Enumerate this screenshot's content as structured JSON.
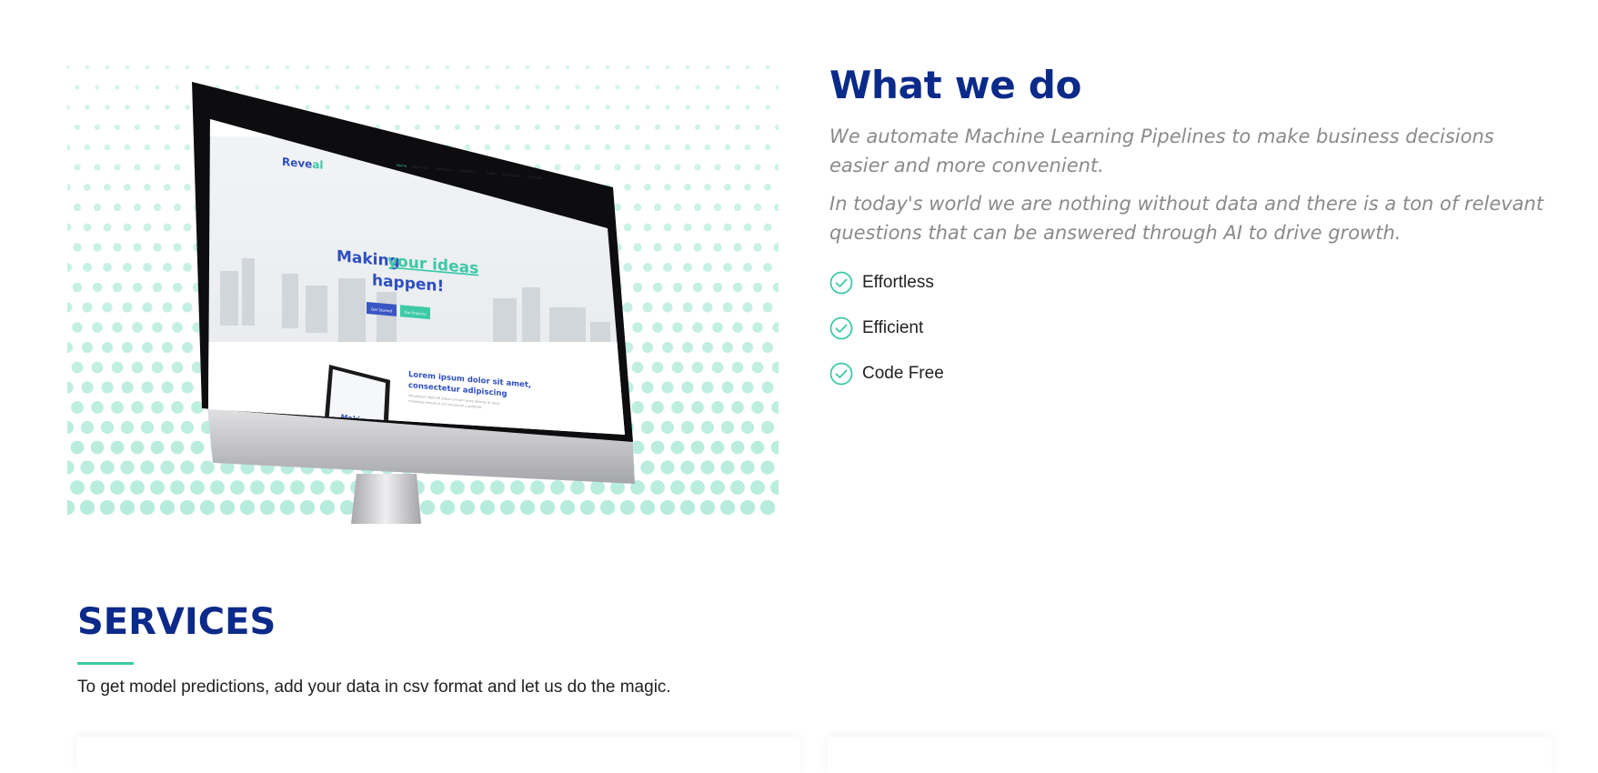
{
  "about": {
    "title": "What we do",
    "lead": "We automate Machine Learning Pipelines to make business decisions easier and more convenient.",
    "text": "In today's world we are nothing without data and there is a ton of relevant questions that can be answered through AI to drive growth.",
    "features": [
      {
        "label": "Effortless",
        "icon": "check-circle-icon"
      },
      {
        "label": "Efficient",
        "icon": "check-circle-icon"
      },
      {
        "label": "Code Free",
        "icon": "check-circle-icon"
      }
    ],
    "mockup": {
      "brand_prefix": "Reve",
      "brand_suffix": "al",
      "headline_1": "Making",
      "headline_2": "your ideas",
      "headline_3": "happen!",
      "primary_button": "Get Started",
      "secondary_button": "Our Projects",
      "nav_items": [
        "Home",
        "About Us",
        "Services",
        "Portfolio",
        "Team",
        "Drop Down",
        "Contact"
      ],
      "section_heading_1": "Lorem ipsum dolor sit amet,",
      "section_heading_2": "consectetur adipiscing",
      "section_text_1": "Voluptatum deleniti atque corrupti quos dolores et quas",
      "section_text_2": "molestias excepturi sint occaecati cupiditate",
      "laptop_text": "Making"
    }
  },
  "services": {
    "title": "SERVICES",
    "description": "To get model predictions, add your data in csv format and let us do the magic."
  },
  "colors": {
    "heading": "#0b2a8a",
    "accent": "#3ec9a7",
    "muted_text": "#8a8a8a",
    "dots": "#b6ecdc"
  }
}
